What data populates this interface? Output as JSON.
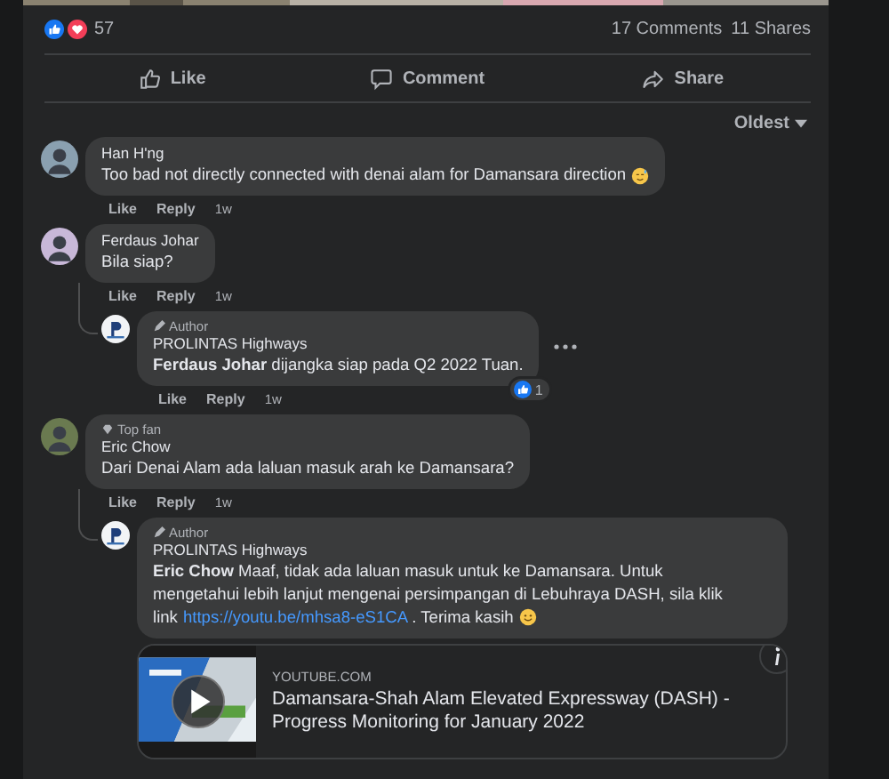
{
  "post": {
    "reactions_count": "57",
    "comments_count": "17 Comments",
    "shares_count": "11 Shares"
  },
  "actions": [
    {
      "kind": "like",
      "label": "Like"
    },
    {
      "kind": "comment",
      "label": "Comment"
    },
    {
      "kind": "share",
      "label": "Share"
    }
  ],
  "sort": {
    "label": "Oldest"
  },
  "comments": [
    {
      "author": "Han H'ng",
      "text": "Too bad not directly connected with denai alam for Damansara direction",
      "emoji": {
        "kind": "sweat"
      },
      "actions": [
        "Like",
        "Reply"
      ],
      "time": "1w"
    },
    {
      "author": "Ferdaus Johar",
      "text": "Bila siap?",
      "actions": [
        "Like",
        "Reply"
      ],
      "time": "1w",
      "children": [
        {
          "author": "PROLINTAS Highways",
          "badge": {
            "kind": "author",
            "label": "Author"
          },
          "text": "**Ferdaus Johar** dijangka siap pada Q2 2022 Tuan.",
          "reaction_count": "1",
          "more": true,
          "actions": [
            "Like",
            "Reply"
          ],
          "time": "1w"
        }
      ]
    },
    {
      "author": "Eric Chow",
      "badge": {
        "kind": "topfan",
        "label": "Top fan"
      },
      "text": "Dari Denai Alam ada laluan masuk arah ke Damansara?",
      "actions": [
        "Like",
        "Reply"
      ],
      "time": "1w",
      "children": [
        {
          "author": "PROLINTAS Highways",
          "badge": {
            "kind": "author",
            "label": "Author"
          },
          "text": "**Eric Chow** Maaf, tidak ada laluan masuk untuk ke Damansara. Untuk mengetahui lebih lanjut mengenai persimpangan di Lebuhraya DASH, sila klik link",
          "link": "https://youtu.be/mhsa8-eS1CA",
          "text_after": " . Terima kasih",
          "emoji": {
            "kind": "smile"
          },
          "preview": {
            "site": "YOUTUBE.COM",
            "title": "Damansara-Shah Alam Elevated Expressway (DASH) - Progress Monitoring for January 2022"
          }
        }
      ]
    }
  ]
}
